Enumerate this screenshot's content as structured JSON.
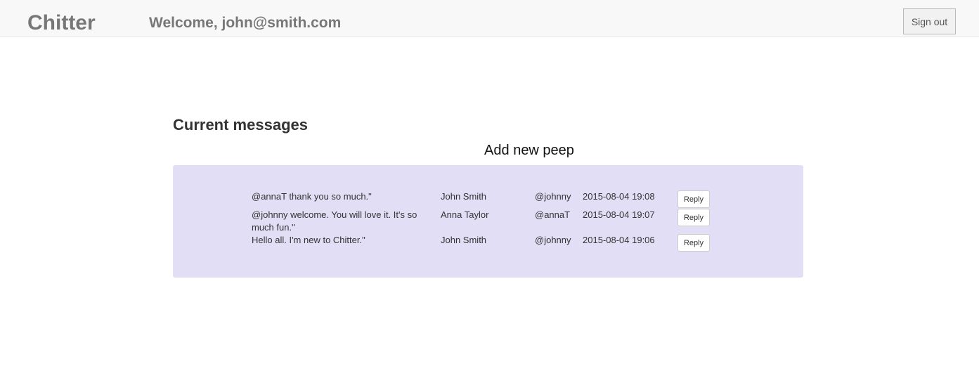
{
  "header": {
    "brand": "Chitter",
    "welcome": "Welcome, john@smith.com",
    "signout_label": "Sign out"
  },
  "main": {
    "section_title": "Current messages",
    "add_peep_label": "Add new peep",
    "reply_label": "Reply",
    "messages": [
      {
        "text": "@annaT thank you so much.\"",
        "name": "John Smith",
        "handle": "@johnny",
        "time": "2015-08-04 19:08"
      },
      {
        "text": "@johnny welcome. You will love it. It's so much fun.\"",
        "name": "Anna Taylor",
        "handle": "@annaT",
        "time": "2015-08-04 19:07"
      },
      {
        "text": "Hello all. I'm new to Chitter.\"",
        "name": "John Smith",
        "handle": "@johnny",
        "time": "2015-08-04 19:06"
      }
    ]
  },
  "colors": {
    "navbar_bg": "#f8f8f8",
    "panel_bg": "#e2def5",
    "brand_text": "#777777"
  }
}
